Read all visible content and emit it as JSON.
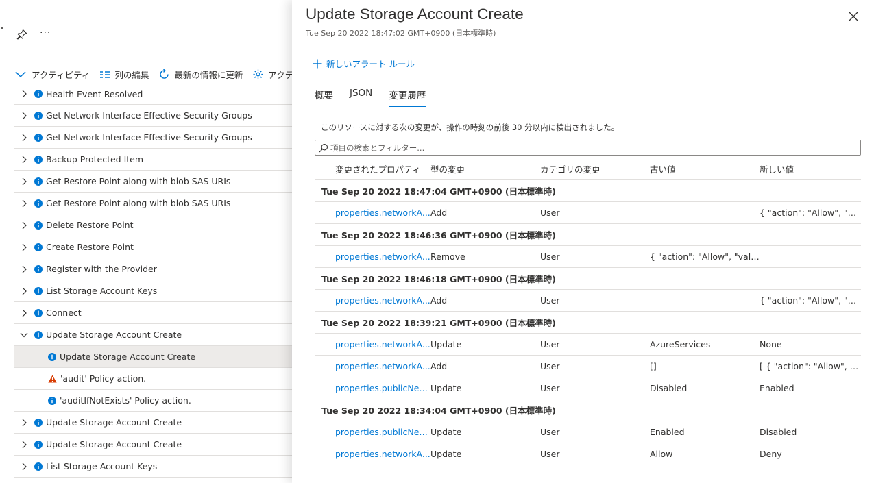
{
  "left": {
    "toolbar": {
      "activity_label": "アクティビティ",
      "edit_columns_label": "列の編集",
      "refresh_label": "最新の情報に更新",
      "settings_label": "アクティビ"
    },
    "tree": [
      {
        "label": "Health Event Resolved",
        "level": 0,
        "icon": "info-icon",
        "chevron": "right"
      },
      {
        "label": "Get Network Interface Effective Security Groups",
        "level": 0,
        "icon": "info-icon",
        "chevron": "right"
      },
      {
        "label": "Get Network Interface Effective Security Groups",
        "level": 0,
        "icon": "info-icon",
        "chevron": "right"
      },
      {
        "label": "Backup Protected Item",
        "level": 0,
        "icon": "info-icon",
        "chevron": "right"
      },
      {
        "label": "Get Restore Point along with blob SAS URIs",
        "level": 0,
        "icon": "info-icon",
        "chevron": "right"
      },
      {
        "label": "Get Restore Point along with blob SAS URIs",
        "level": 0,
        "icon": "info-icon",
        "chevron": "right"
      },
      {
        "label": "Delete Restore Point",
        "level": 0,
        "icon": "info-icon",
        "chevron": "right"
      },
      {
        "label": "Create Restore Point",
        "level": 0,
        "icon": "info-icon",
        "chevron": "right"
      },
      {
        "label": "Register with the Provider",
        "level": 0,
        "icon": "info-icon",
        "chevron": "right"
      },
      {
        "label": "List Storage Account Keys",
        "level": 0,
        "icon": "info-icon",
        "chevron": "right"
      },
      {
        "label": "Connect",
        "level": 0,
        "icon": "info-icon",
        "chevron": "right"
      },
      {
        "label": "Update Storage Account Create",
        "level": 0,
        "icon": "info-icon",
        "chevron": "down"
      },
      {
        "label": "Update Storage Account Create",
        "level": 1,
        "icon": "info-icon",
        "chevron": "none",
        "selected": true
      },
      {
        "label": "'audit' Policy action.",
        "level": 1,
        "icon": "warning-icon",
        "chevron": "none"
      },
      {
        "label": "'auditIfNotExists' Policy action.",
        "level": 1,
        "icon": "info-icon",
        "chevron": "none"
      },
      {
        "label": "Update Storage Account Create",
        "level": 0,
        "icon": "info-icon",
        "chevron": "right"
      },
      {
        "label": "Update Storage Account Create",
        "level": 0,
        "icon": "info-icon",
        "chevron": "right"
      },
      {
        "label": "List Storage Account Keys",
        "level": 0,
        "icon": "info-icon",
        "chevron": "right"
      }
    ]
  },
  "panel": {
    "title": "Update Storage Account Create",
    "subtitle": "Tue Sep 20 2022 18:47:02 GMT+0900 (日本標準時)",
    "new_alert_rule_label": "新しいアラート ルール",
    "tabs": [
      {
        "label": "概要",
        "active": false
      },
      {
        "label": "JSON",
        "active": false
      },
      {
        "label": "変更履歴",
        "active": true
      }
    ],
    "note": "このリソースに対する次の変更が、操作の時刻の前後 30 分以内に検出されました。",
    "search_placeholder": "項目の検索とフィルター...",
    "columns": {
      "property": "変更されたプロパティ",
      "type": "型の変更",
      "category": "カテゴリの変更",
      "old": "古い値",
      "new": "新しい値"
    },
    "groups": [
      {
        "time": "Tue Sep 20 2022 18:47:04 GMT+0900 (日本標準時)",
        "rows": [
          {
            "property": "properties.networkA...",
            "type": "Add",
            "category": "User",
            "old": "",
            "new": "{ \"action\": \"Allow\", \"valu..."
          }
        ]
      },
      {
        "time": "Tue Sep 20 2022 18:46:36 GMT+0900 (日本標準時)",
        "rows": [
          {
            "property": "properties.networkA...",
            "type": "Remove",
            "category": "User",
            "old": "{ \"action\": \"Allow\", \"valu...",
            "new": ""
          }
        ]
      },
      {
        "time": "Tue Sep 20 2022 18:46:18 GMT+0900 (日本標準時)",
        "rows": [
          {
            "property": "properties.networkA...",
            "type": "Add",
            "category": "User",
            "old": "",
            "new": "{ \"action\": \"Allow\", \"valu..."
          }
        ]
      },
      {
        "time": "Tue Sep 20 2022 18:39:21 GMT+0900 (日本標準時)",
        "rows": [
          {
            "property": "properties.networkA...",
            "type": "Update",
            "category": "User",
            "old": "AzureServices",
            "new": "None"
          },
          {
            "property": "properties.networkA...",
            "type": "Add",
            "category": "User",
            "old": "[]",
            "new": "[ { \"action\": \"Allow\", \"val..."
          },
          {
            "property": "properties.publicNet...",
            "type": "Update",
            "category": "User",
            "old": "Disabled",
            "new": "Enabled"
          }
        ]
      },
      {
        "time": "Tue Sep 20 2022 18:34:04 GMT+0900 (日本標準時)",
        "rows": [
          {
            "property": "properties.publicNet...",
            "type": "Update",
            "category": "User",
            "old": "Enabled",
            "new": "Disabled"
          },
          {
            "property": "properties.networkA...",
            "type": "Update",
            "category": "User",
            "old": "Allow",
            "new": "Deny"
          }
        ]
      }
    ]
  },
  "colors": {
    "accent": "#0078d4",
    "warning": "#d83b01",
    "text": "#323130",
    "selected_row": "#edebe9"
  }
}
